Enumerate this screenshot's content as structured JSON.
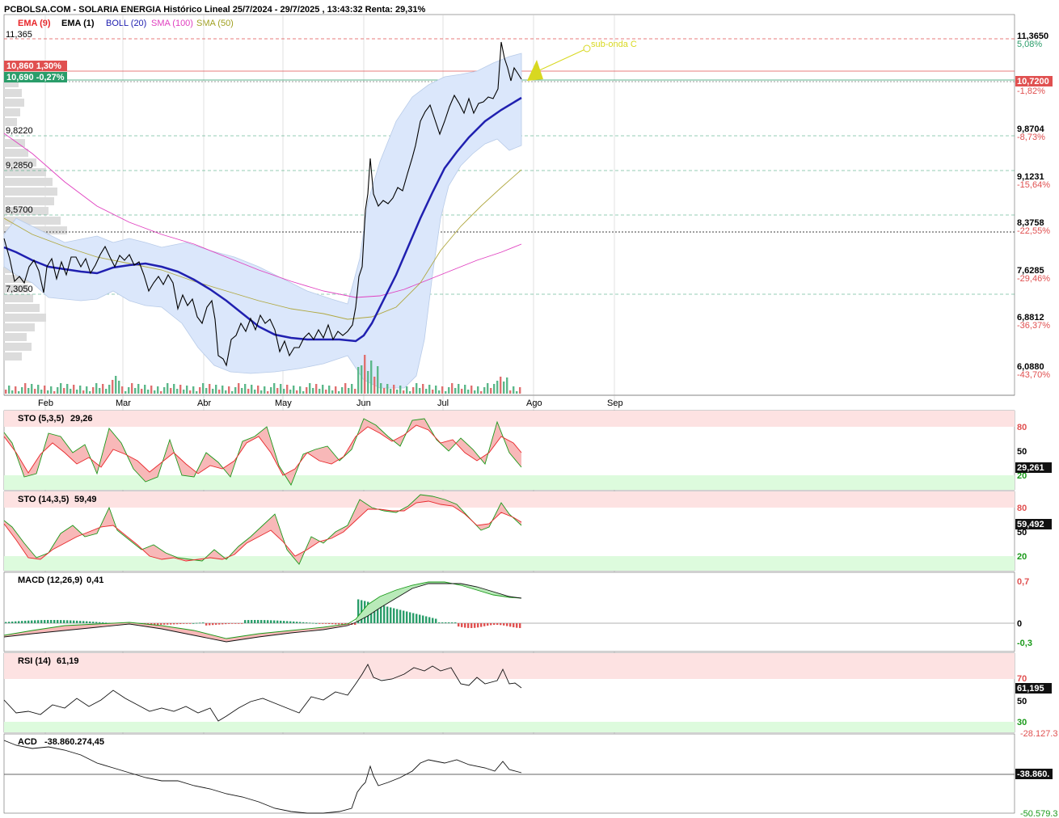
{
  "header": {
    "title": "PCBOLSA.COM - SOLARIA ENERGIA Histórico Lineal 25/7/2024 - 29/7/2025 , 13:43:32 Renta: 29,31%"
  },
  "legend": [
    {
      "label": "EMA (9)",
      "color": "#e8262a"
    },
    {
      "label": "EMA (1)",
      "color": "#000000"
    },
    {
      "label": "BOLL (20)",
      "color": "#2020b0"
    },
    {
      "label": "SMA (100)",
      "color": "#e040c0"
    },
    {
      "label": "SMA (50)",
      "color": "#a0a020"
    }
  ],
  "colors": {
    "price": "#000000",
    "boll_mid": "#2020b0",
    "boll_band": "#dbe7fb",
    "sma100": "#e040c0",
    "sma50": "#b0a840",
    "up": "#2a9d6a",
    "down": "#e05050",
    "overbought": "#fde2e2",
    "oversold": "#ddfbdd",
    "annotation": "#d8d820"
  },
  "price_panel": {
    "left_levels": [
      "11,365",
      "9,8220",
      "9,2850",
      "8,5700",
      "7,3050"
    ],
    "right_levels": [
      {
        "value": "11,3650",
        "pct": "5,08%"
      },
      {
        "value": "9,8704",
        "pct": "-8,73%"
      },
      {
        "value": "9,1231",
        "pct": "-15,64%"
      },
      {
        "value": "8,3758",
        "pct": "-22,55%"
      },
      {
        "value": "7,6285",
        "pct": "-29,46%"
      },
      {
        "value": "6,8812",
        "pct": "-36,37%"
      },
      {
        "value": "6,0880",
        "pct": "-43,70%"
      }
    ],
    "current_price": "10,7200",
    "current_pct": "-1,82%",
    "tag_red": "10,860  1,30%",
    "tag_green": "10,690  -0,27%",
    "annotation": "sub-onda  C",
    "months": [
      "Feb",
      "Mar",
      "Abr",
      "May",
      "Jun",
      "Jul",
      "Ago",
      "Sep"
    ]
  },
  "indicators": {
    "sto1": {
      "label": "STO (5,3,5)",
      "value": "29,26",
      "badge": "29,261",
      "levels": [
        "80",
        "50",
        "20"
      ]
    },
    "sto2": {
      "label": "STO (14,3,5)",
      "value": "59,49",
      "badge": "59,492",
      "levels": [
        "80",
        "50",
        "20"
      ]
    },
    "macd": {
      "label": "MACD (12,26,9)",
      "value": "0,41",
      "levels": [
        "0,7",
        "0",
        "-0,3"
      ]
    },
    "rsi": {
      "label": "RSI (14)",
      "value": "61,19",
      "badge": "61,195",
      "levels": [
        "70",
        "50",
        "30"
      ]
    },
    "acd": {
      "label": "ACD",
      "value": "-38.860.274,45",
      "badge": "-38.860.",
      "top": "-28.127.3",
      "bottom": "-50.579.3"
    }
  },
  "chart_data": {
    "type": "line",
    "title": "PCBOLSA.COM - SOLARIA ENERGIA Histórico Lineal 25/7/2024 - 29/7/2025 , 13:43:32 Renta: 29,31%",
    "x_ticks": [
      "Feb",
      "Mar",
      "Abr",
      "May",
      "Jun",
      "Jul",
      "Ago",
      "Sep"
    ],
    "ylim": [
      5.85,
      11.55
    ],
    "series": [
      {
        "name": "EMA (1)",
        "points": [
          [
            0,
            8.0
          ],
          [
            2,
            7.8
          ],
          [
            4,
            7.35
          ],
          [
            6,
            7.4
          ],
          [
            8,
            7.55
          ],
          [
            10,
            7.8
          ],
          [
            12,
            7.6
          ],
          [
            14,
            7.7
          ],
          [
            16,
            7.85
          ],
          [
            18,
            7.7
          ],
          [
            20,
            7.75
          ],
          [
            22,
            7.6
          ],
          [
            24,
            7.7
          ],
          [
            26,
            7.85
          ],
          [
            28,
            7.8
          ],
          [
            30,
            7.75
          ],
          [
            32,
            7.7
          ],
          [
            34,
            7.8
          ],
          [
            36,
            7.9
          ],
          [
            38,
            7.75
          ],
          [
            40,
            7.85
          ],
          [
            42,
            7.75
          ],
          [
            44,
            7.65
          ],
          [
            46,
            7.6
          ],
          [
            48,
            7.5
          ],
          [
            50,
            7.25
          ],
          [
            52,
            7.15
          ],
          [
            54,
            7.0
          ],
          [
            56,
            6.9
          ],
          [
            58,
            6.8
          ],
          [
            60,
            7.1
          ],
          [
            62,
            6.5
          ],
          [
            64,
            6.3
          ],
          [
            66,
            6.55
          ],
          [
            68,
            6.7
          ],
          [
            70,
            6.5
          ],
          [
            72,
            6.6
          ],
          [
            74,
            6.6
          ],
          [
            76,
            6.5
          ],
          [
            78,
            6.6
          ],
          [
            80,
            6.7
          ],
          [
            82,
            6.4
          ],
          [
            84,
            6.5
          ],
          [
            86,
            6.55
          ],
          [
            88,
            6.5
          ],
          [
            90,
            6.6
          ],
          [
            92,
            6.55
          ],
          [
            94,
            6.6
          ],
          [
            96,
            6.7
          ],
          [
            98,
            6.55
          ],
          [
            100,
            6.6
          ],
          [
            102,
            7.3
          ],
          [
            104,
            8.6
          ],
          [
            106,
            10.2
          ],
          [
            108,
            9.1
          ],
          [
            110,
            8.8
          ],
          [
            112,
            8.7
          ],
          [
            114,
            8.8
          ],
          [
            116,
            9.3
          ],
          [
            118,
            9.7
          ],
          [
            120,
            9.75
          ],
          [
            122,
            9.9
          ],
          [
            124,
            10.2
          ],
          [
            126,
            10.4
          ],
          [
            128,
            10.6
          ],
          [
            130,
            10.3
          ],
          [
            132,
            10.5
          ],
          [
            134,
            10.4
          ],
          [
            136,
            10.5
          ],
          [
            138,
            10.6
          ],
          [
            140,
            10.5
          ],
          [
            142,
            10.8
          ],
          [
            144,
            11.3
          ],
          [
            146,
            10.9
          ],
          [
            148,
            10.75
          ],
          [
            150,
            10.72
          ]
        ]
      },
      {
        "name": "BOLL (20)",
        "points": [
          [
            0,
            8.0
          ],
          [
            10,
            7.75
          ],
          [
            20,
            7.72
          ],
          [
            30,
            7.78
          ],
          [
            40,
            7.78
          ],
          [
            50,
            7.6
          ],
          [
            60,
            7.2
          ],
          [
            70,
            6.85
          ],
          [
            80,
            6.62
          ],
          [
            90,
            6.58
          ],
          [
            100,
            6.56
          ],
          [
            106,
            6.9
          ],
          [
            112,
            7.6
          ],
          [
            118,
            8.3
          ],
          [
            124,
            8.9
          ],
          [
            130,
            9.3
          ],
          [
            136,
            9.65
          ],
          [
            142,
            9.9
          ],
          [
            150,
            10.2
          ]
        ]
      },
      {
        "name": "SMA (100)",
        "points": [
          [
            0,
            9.8
          ],
          [
            20,
            9.0
          ],
          [
            40,
            8.5
          ],
          [
            60,
            8.0
          ],
          [
            80,
            7.6
          ],
          [
            100,
            7.4
          ],
          [
            110,
            7.45
          ],
          [
            120,
            7.65
          ],
          [
            130,
            7.9
          ],
          [
            150,
            8.2
          ]
        ]
      },
      {
        "name": "SMA (50)",
        "points": [
          [
            0,
            8.4
          ],
          [
            20,
            8.1
          ],
          [
            40,
            7.85
          ],
          [
            60,
            7.55
          ],
          [
            80,
            7.2
          ],
          [
            100,
            7.0
          ],
          [
            110,
            7.2
          ],
          [
            120,
            7.7
          ],
          [
            130,
            8.3
          ],
          [
            140,
            8.8
          ],
          [
            150,
            9.2
          ]
        ]
      }
    ]
  }
}
